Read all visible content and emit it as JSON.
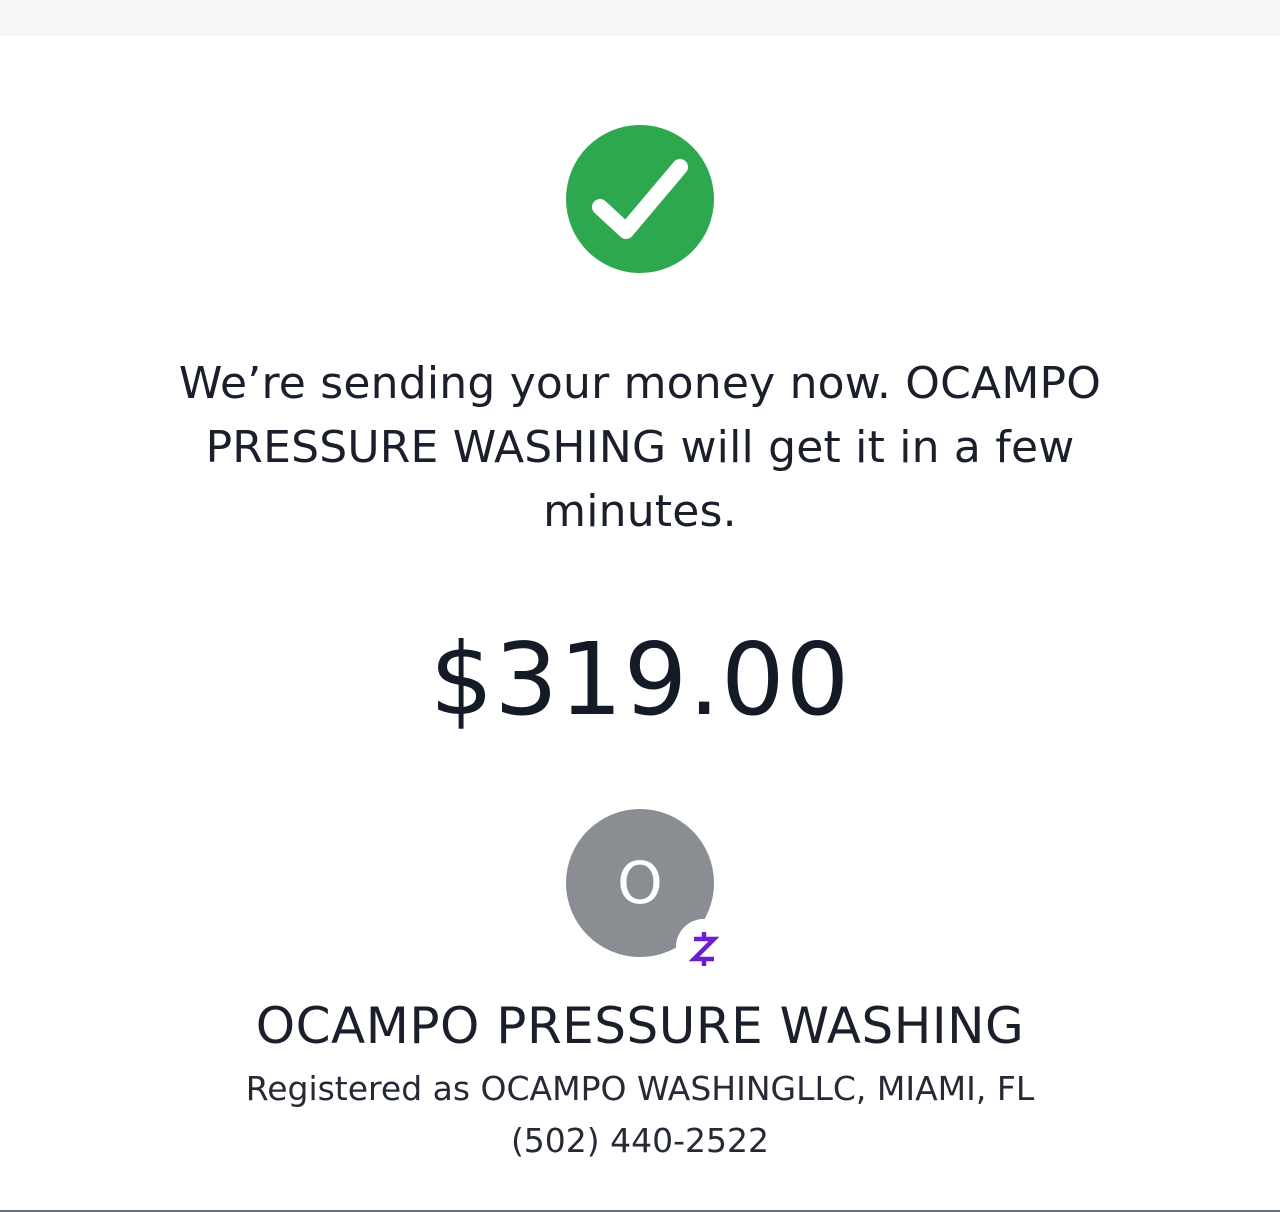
{
  "status": {
    "icon": "checkmark-icon",
    "color": "#2ea84f",
    "message": "We’re sending your money now. OCAMPO PRESSURE WASHING will get it in a few minutes."
  },
  "payment": {
    "amount": "$319.00"
  },
  "recipient": {
    "avatar_initial": "O",
    "avatar_color": "#8a8d91",
    "badge_icon": "zelle-icon",
    "badge_color": "#6d1ed4",
    "name": "OCAMPO PRESSURE WASHING",
    "registered": "Registered as OCAMPO WASHINGLLC, MIAMI, FL",
    "phone": "(502) 440-2522"
  }
}
